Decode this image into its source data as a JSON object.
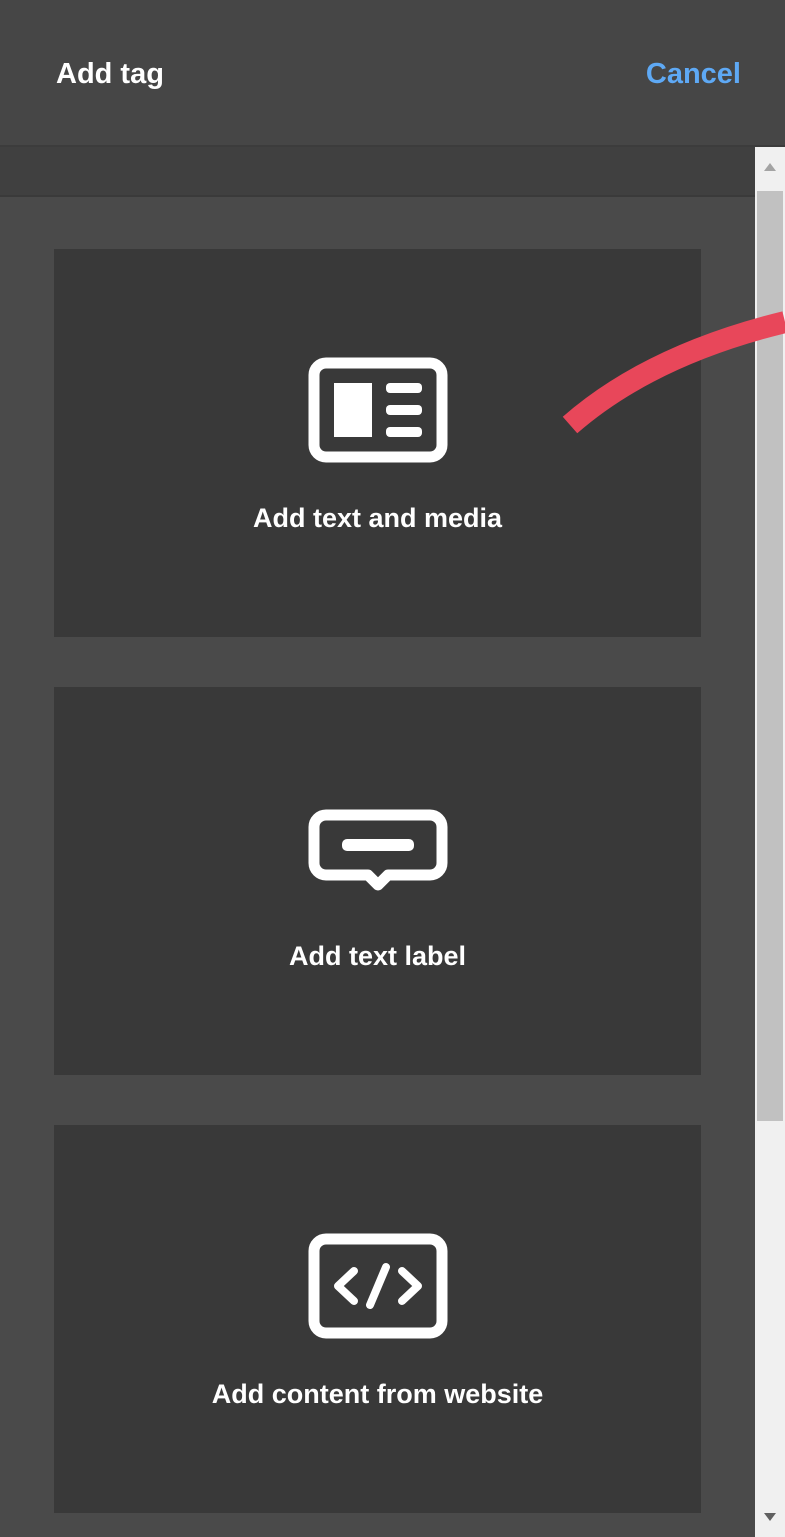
{
  "header": {
    "title": "Add tag",
    "cancel_label": "Cancel"
  },
  "options": [
    {
      "label": "Add text and media",
      "icon": "text-media-icon"
    },
    {
      "label": "Add text label",
      "icon": "text-label-icon"
    },
    {
      "label": "Add content from website",
      "icon": "code-icon"
    }
  ],
  "colors": {
    "header_bg": "#464646",
    "panel_bg": "#4a4a4a",
    "card_bg": "#393939",
    "accent": "#5ea9f5",
    "annotation": "#e8475a"
  }
}
